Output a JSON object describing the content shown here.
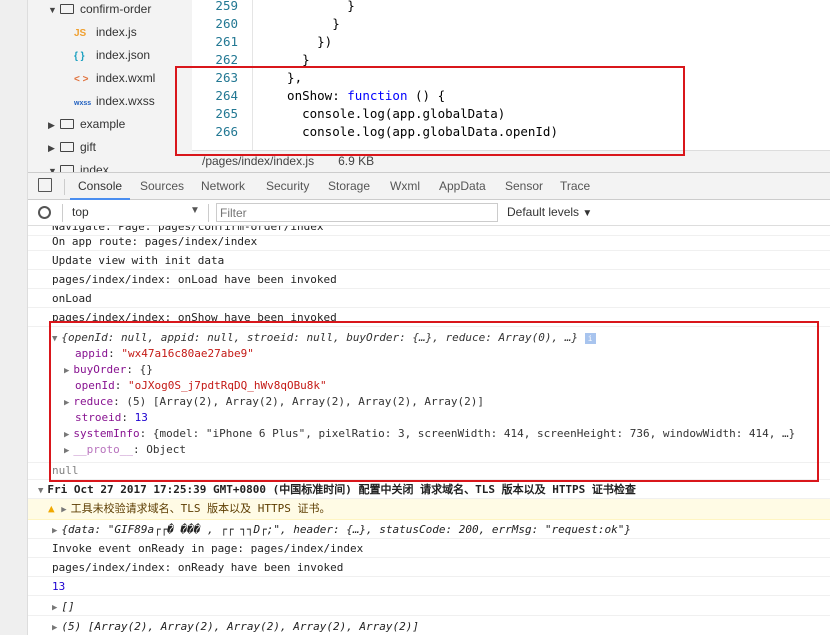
{
  "tree": {
    "items": [
      {
        "label": "confirm-order",
        "type": "folder-open"
      },
      {
        "label": "index.js",
        "type": "js",
        "icon_text": "JS"
      },
      {
        "label": "index.json",
        "type": "json",
        "icon_text": "{ }"
      },
      {
        "label": "index.wxml",
        "type": "wxml",
        "icon_text": "< >"
      },
      {
        "label": "index.wxss",
        "type": "wxss",
        "icon_text": "wxss"
      },
      {
        "label": "example",
        "type": "folder"
      },
      {
        "label": "gift",
        "type": "folder"
      },
      {
        "label": "index",
        "type": "folder-open"
      }
    ]
  },
  "editor": {
    "lines": [
      {
        "num": "259",
        "code": "          }"
      },
      {
        "num": "260",
        "code": "        }"
      },
      {
        "num": "261",
        "code": "      })"
      },
      {
        "num": "262",
        "code": "    }"
      },
      {
        "num": "263",
        "code": "  },"
      },
      {
        "num": "264",
        "code": "  onShow: ",
        "kw": "function",
        "rest": " () {"
      },
      {
        "num": "265",
        "code": "    console.log(app.globalData)"
      },
      {
        "num": "266",
        "code": "    console.log(app.globalData.openId)"
      }
    ],
    "status_path": "/pages/index/index.js",
    "status_size": "6.9 KB"
  },
  "devtools": {
    "tabs": [
      "Console",
      "Sources",
      "Network",
      "Security",
      "Storage",
      "Wxml",
      "AppData",
      "Sensor",
      "Trace"
    ],
    "context": "top",
    "filter_placeholder": "Filter",
    "levels": "Default levels"
  },
  "console": {
    "lines_top": [
      "Navigate: Page: pages/confirm-order/index",
      "On app route: pages/index/index",
      "Update view with init data",
      "pages/index/index: onLoad have been invoked",
      "onLoad",
      "pages/index/index: onShow have been invoked"
    ],
    "obj_summary": "{openId: null, appid: null, stroeid: null, buyOrder: {…}, reduce: Array(0), …}",
    "appid_key": "appid",
    "appid_val": "\"wx47a16c80ae27abe9\"",
    "buyOrder_key": "buyOrder",
    "buyOrder_val": "{}",
    "openId_key": "openId",
    "openId_val": "\"oJXog0S_j7pdtRqDQ_hWv8qOBu8k\"",
    "reduce_key": "reduce",
    "reduce_val": "(5) [Array(2), Array(2), Array(2), Array(2), Array(2)]",
    "stroeid_key": "stroeid",
    "stroeid_val": "13",
    "systemInfo_key": "systemInfo",
    "systemInfo_val": "{model: \"iPhone 6 Plus\", pixelRatio: 3, screenWidth: 414, screenHeight: 736, windowWidth: 414, …}",
    "proto_key": "__proto__",
    "proto_val": "Object",
    "null_line": "null",
    "group_title": "Fri Oct 27 2017 17:25:39 GMT+0800 (中国标准时间) 配置中关闭 请求域名、TLS 版本以及 HTTPS 证书检查",
    "warning": "工具未校验请求域名、TLS 版本以及 HTTPS 证书。",
    "data_line": "{data: \"GIF89a┌┌�  ���   ,    ┌┌ ┐┐D┌;\", header: {…}, statusCode: 200, errMsg: \"request:ok\"}",
    "lines_bottom": [
      "Invoke event onReady in page: pages/index/index",
      "pages/index/index: onReady have been invoked"
    ],
    "num_line": "13",
    "empty_arr": "[]",
    "arr_line": "(5) [Array(2), Array(2), Array(2), Array(2), Array(2)]"
  }
}
